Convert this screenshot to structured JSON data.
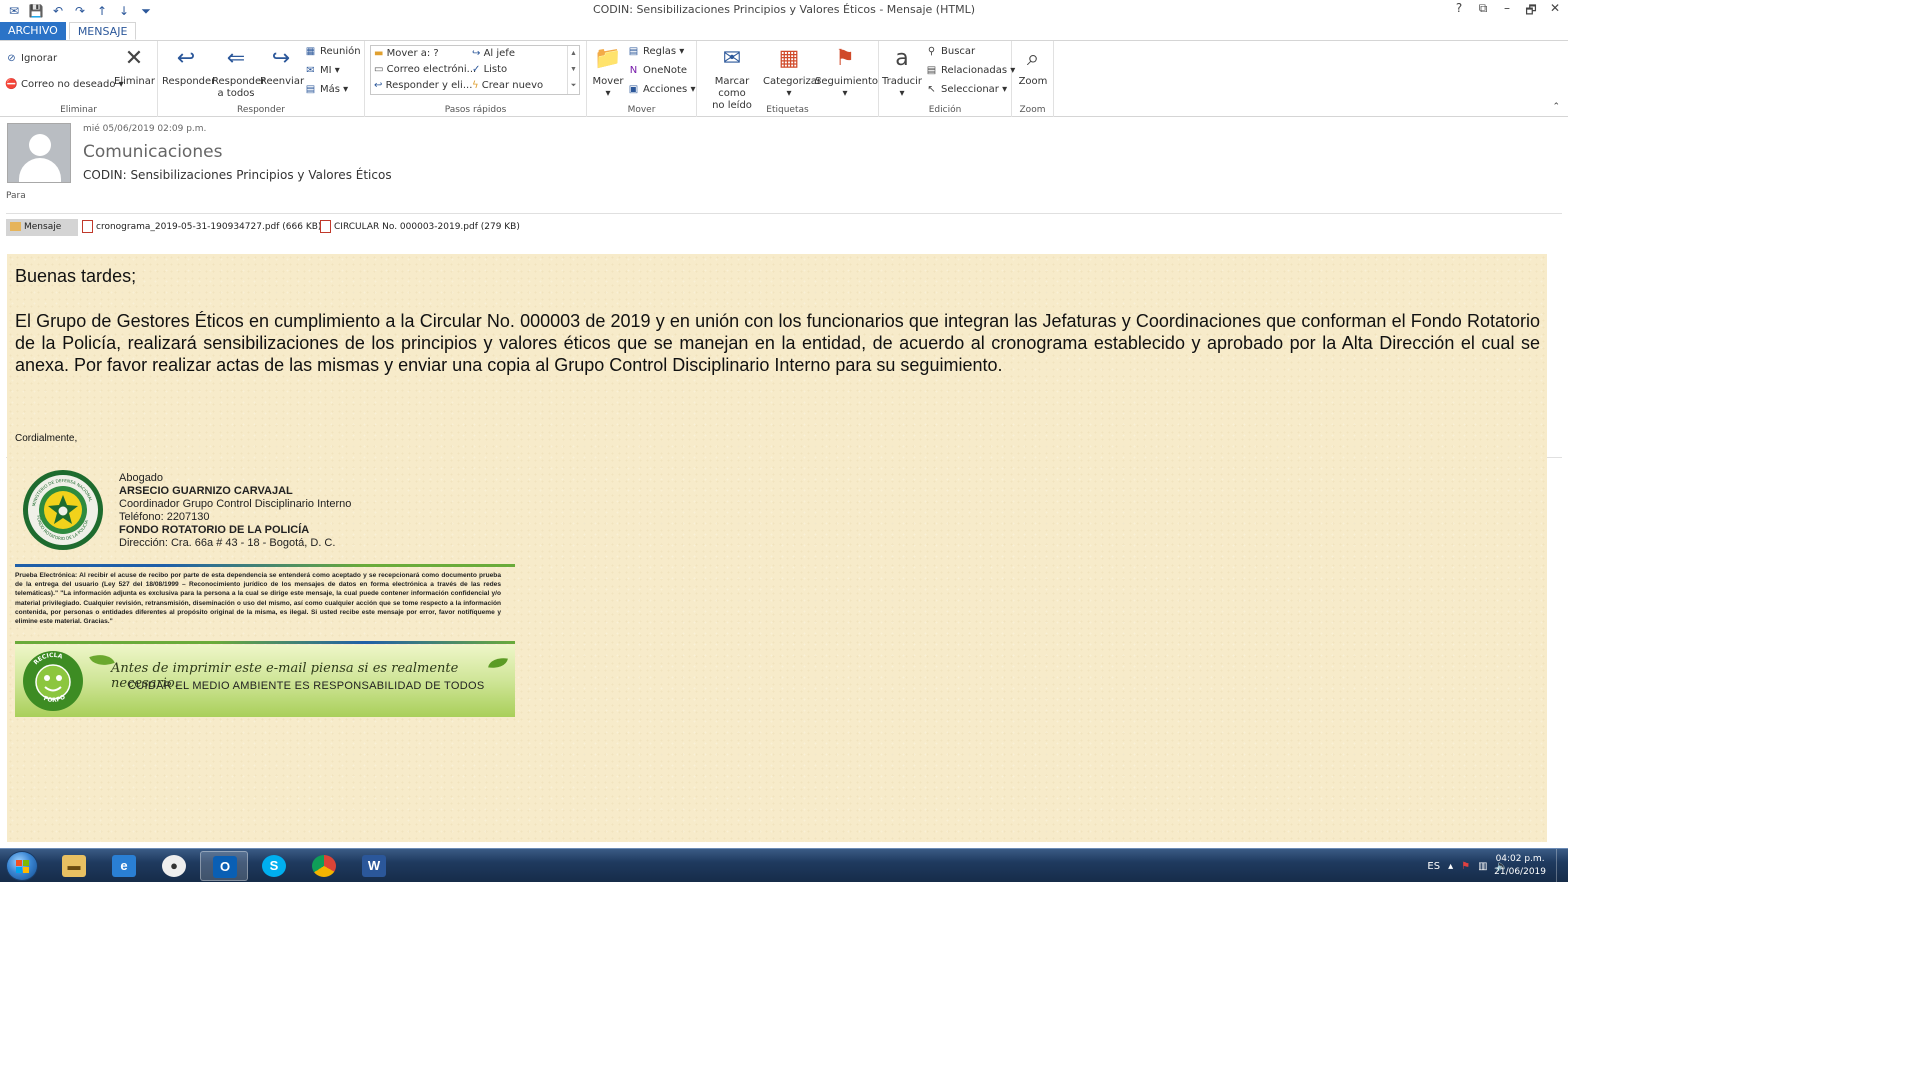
{
  "window": {
    "title": "CODIN: Sensibilizaciones Principios y Valores Éticos - Mensaje (HTML)",
    "controls": [
      "?",
      "⧉",
      "–",
      "🗗",
      "✕"
    ]
  },
  "quick_access": [
    "mail-icon",
    "save-icon",
    "undo-icon",
    "redo-icon",
    "up-icon",
    "down-icon",
    "customize-icon"
  ],
  "tabs": {
    "file": "ARCHIVO",
    "message": "MENSAJE"
  },
  "ribbon": {
    "eliminar": {
      "label": "Eliminar",
      "ignore": "Ignorar",
      "junk": "Correo no deseado",
      "delete": "Eliminar"
    },
    "responder": {
      "label": "Responder",
      "reply": "Responder",
      "reply_all_1": "Responder",
      "reply_all_2": "a todos",
      "forward": "Reenviar",
      "meeting": "Reunión",
      "im": "MI",
      "more": "Más"
    },
    "pasos": {
      "label": "Pasos rápidos",
      "move_to": "Mover a: ?",
      "email": "Correo electróni...",
      "reply_del": "Responder y eli...",
      "to_boss": "Al jefe",
      "done": "Listo",
      "create": "Crear nuevo"
    },
    "mover": {
      "label": "Mover",
      "move": "Mover",
      "rules": "Reglas",
      "onenote": "OneNote",
      "actions": "Acciones"
    },
    "etiquetas": {
      "label": "Etiquetas",
      "mark_unread_1": "Marcar como",
      "mark_unread_2": "no leído",
      "categorize": "Categorizar",
      "followup": "Seguimiento"
    },
    "edicion": {
      "label": "Edición",
      "translate": "Traducir",
      "find": "Buscar",
      "related": "Relacionadas",
      "select": "Seleccionar"
    },
    "zoom": {
      "label": "Zoom",
      "zoom": "Zoom"
    }
  },
  "header": {
    "date": "mié 05/06/2019 02:09 p.m.",
    "from": "Comunicaciones",
    "subject": "CODIN: Sensibilizaciones Principios y Valores Éticos",
    "to_label": "Para"
  },
  "attachments": [
    {
      "name": "Mensaje"
    },
    {
      "name": "cronograma_2019-05-31-190934727.pdf (666 KB)"
    },
    {
      "name": "CIRCULAR No. 000003-2019.pdf (279 KB)"
    }
  ],
  "body": {
    "greeting": "Buenas tardes;",
    "paragraph": "El Grupo de Gestores Éticos en cumplimiento a la Circular No. 000003 de 2019 y en unión con los funcionarios que integran las Jefaturas y Coordinaciones que conforman el Fondo Rotatorio de la Policía, realizará sensibilizaciones de los principios y valores éticos que se manejan en la entidad, de acuerdo al cronograma establecido y aprobado por la Alta Dirección el cual se anexa.  Por favor realizar actas de las mismas y enviar una copia al Grupo Control Disciplinario Interno para su seguimiento.",
    "closing": "Cordialmente,",
    "signature": {
      "role": "Abogado",
      "name": "ARSECIO GUARNIZO CARVAJAL",
      "position": "Coordinador Grupo Control Disciplinario Interno",
      "phone": "Teléfono: 2207130",
      "org": "FONDO ROTATORIO DE LA POLICÍA",
      "address": "Dirección: Cra. 66a # 43 - 18 - Bogotá, D. C."
    },
    "legal": "Prueba Electrónica:  Al recibir el acuse de recibo por parte de esta dependencia se entenderá como aceptado y se recepcionará como documento prueba de la entrega del usuario (Ley 527 del 18/08/1999 – Reconocimiento jurídico de los mensajes de datos en forma electrónica a través de las redes telemáticas).\" \"La información adjunta es exclusiva para la persona a la cual se dirige este mensaje, la cual puede contener información confidencial y/o material privilegiado. Cualquier revisión, retransmisión, diseminación o uso del mismo, así como cualquier acción que se tome respecto a la información contenida, por personas o entidades diferentes al propósito original de la misma, es ilegal. Si usted recibe este mensaje por error, favor notifíqueme y elimine este material. Gracias.\"",
    "eco_line1": "Antes de imprimir este e-mail piensa si es realmente necesario.",
    "eco_line2": "CUIDAR EL MEDIO AMBIENTE ES RESPONSABILIDAD DE TODOS",
    "seal_text_top": "MINISTERIO DE DEFENSA NACIONAL",
    "seal_text_bottom": "FONDO ROTATORIO DE LA POLICÍA",
    "eco_logo_top": "RECICLA",
    "eco_logo_bottom": "FORPO"
  },
  "taskbar": {
    "apps": [
      "Explorador",
      "Internet Explorer",
      "Pidgin",
      "Outlook",
      "Skype",
      "Chrome",
      "Word"
    ],
    "lang": "ES",
    "time": "04:02 p.m.",
    "date": "21/06/2019"
  }
}
